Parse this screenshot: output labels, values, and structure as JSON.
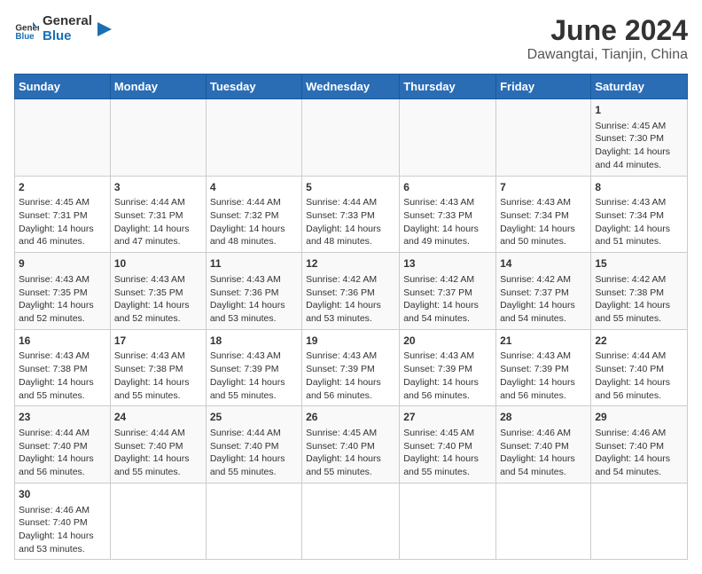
{
  "logo": {
    "text_general": "General",
    "text_blue": "Blue"
  },
  "title": "June 2024",
  "subtitle": "Dawangtai, Tianjin, China",
  "days_of_week": [
    "Sunday",
    "Monday",
    "Tuesday",
    "Wednesday",
    "Thursday",
    "Friday",
    "Saturday"
  ],
  "weeks": [
    [
      {
        "day": "",
        "info": ""
      },
      {
        "day": "",
        "info": ""
      },
      {
        "day": "",
        "info": ""
      },
      {
        "day": "",
        "info": ""
      },
      {
        "day": "",
        "info": ""
      },
      {
        "day": "",
        "info": ""
      },
      {
        "day": "1",
        "info": "Sunrise: 4:45 AM\nSunset: 7:30 PM\nDaylight: 14 hours and 44 minutes."
      }
    ],
    [
      {
        "day": "2",
        "info": "Sunrise: 4:45 AM\nSunset: 7:31 PM\nDaylight: 14 hours and 46 minutes."
      },
      {
        "day": "3",
        "info": "Sunrise: 4:44 AM\nSunset: 7:31 PM\nDaylight: 14 hours and 47 minutes."
      },
      {
        "day": "4",
        "info": "Sunrise: 4:44 AM\nSunset: 7:32 PM\nDaylight: 14 hours and 48 minutes."
      },
      {
        "day": "5",
        "info": "Sunrise: 4:44 AM\nSunset: 7:33 PM\nDaylight: 14 hours and 48 minutes."
      },
      {
        "day": "6",
        "info": "Sunrise: 4:43 AM\nSunset: 7:33 PM\nDaylight: 14 hours and 49 minutes."
      },
      {
        "day": "7",
        "info": "Sunrise: 4:43 AM\nSunset: 7:34 PM\nDaylight: 14 hours and 50 minutes."
      },
      {
        "day": "8",
        "info": "Sunrise: 4:43 AM\nSunset: 7:34 PM\nDaylight: 14 hours and 51 minutes."
      }
    ],
    [
      {
        "day": "9",
        "info": "Sunrise: 4:43 AM\nSunset: 7:35 PM\nDaylight: 14 hours and 52 minutes."
      },
      {
        "day": "10",
        "info": "Sunrise: 4:43 AM\nSunset: 7:35 PM\nDaylight: 14 hours and 52 minutes."
      },
      {
        "day": "11",
        "info": "Sunrise: 4:43 AM\nSunset: 7:36 PM\nDaylight: 14 hours and 53 minutes."
      },
      {
        "day": "12",
        "info": "Sunrise: 4:42 AM\nSunset: 7:36 PM\nDaylight: 14 hours and 53 minutes."
      },
      {
        "day": "13",
        "info": "Sunrise: 4:42 AM\nSunset: 7:37 PM\nDaylight: 14 hours and 54 minutes."
      },
      {
        "day": "14",
        "info": "Sunrise: 4:42 AM\nSunset: 7:37 PM\nDaylight: 14 hours and 54 minutes."
      },
      {
        "day": "15",
        "info": "Sunrise: 4:42 AM\nSunset: 7:38 PM\nDaylight: 14 hours and 55 minutes."
      }
    ],
    [
      {
        "day": "16",
        "info": "Sunrise: 4:43 AM\nSunset: 7:38 PM\nDaylight: 14 hours and 55 minutes."
      },
      {
        "day": "17",
        "info": "Sunrise: 4:43 AM\nSunset: 7:38 PM\nDaylight: 14 hours and 55 minutes."
      },
      {
        "day": "18",
        "info": "Sunrise: 4:43 AM\nSunset: 7:39 PM\nDaylight: 14 hours and 55 minutes."
      },
      {
        "day": "19",
        "info": "Sunrise: 4:43 AM\nSunset: 7:39 PM\nDaylight: 14 hours and 56 minutes."
      },
      {
        "day": "20",
        "info": "Sunrise: 4:43 AM\nSunset: 7:39 PM\nDaylight: 14 hours and 56 minutes."
      },
      {
        "day": "21",
        "info": "Sunrise: 4:43 AM\nSunset: 7:39 PM\nDaylight: 14 hours and 56 minutes."
      },
      {
        "day": "22",
        "info": "Sunrise: 4:44 AM\nSunset: 7:40 PM\nDaylight: 14 hours and 56 minutes."
      }
    ],
    [
      {
        "day": "23",
        "info": "Sunrise: 4:44 AM\nSunset: 7:40 PM\nDaylight: 14 hours and 56 minutes."
      },
      {
        "day": "24",
        "info": "Sunrise: 4:44 AM\nSunset: 7:40 PM\nDaylight: 14 hours and 55 minutes."
      },
      {
        "day": "25",
        "info": "Sunrise: 4:44 AM\nSunset: 7:40 PM\nDaylight: 14 hours and 55 minutes."
      },
      {
        "day": "26",
        "info": "Sunrise: 4:45 AM\nSunset: 7:40 PM\nDaylight: 14 hours and 55 minutes."
      },
      {
        "day": "27",
        "info": "Sunrise: 4:45 AM\nSunset: 7:40 PM\nDaylight: 14 hours and 55 minutes."
      },
      {
        "day": "28",
        "info": "Sunrise: 4:46 AM\nSunset: 7:40 PM\nDaylight: 14 hours and 54 minutes."
      },
      {
        "day": "29",
        "info": "Sunrise: 4:46 AM\nSunset: 7:40 PM\nDaylight: 14 hours and 54 minutes."
      }
    ],
    [
      {
        "day": "30",
        "info": "Sunrise: 4:46 AM\nSunset: 7:40 PM\nDaylight: 14 hours and 53 minutes."
      },
      {
        "day": "",
        "info": ""
      },
      {
        "day": "",
        "info": ""
      },
      {
        "day": "",
        "info": ""
      },
      {
        "day": "",
        "info": ""
      },
      {
        "day": "",
        "info": ""
      },
      {
        "day": "",
        "info": ""
      }
    ]
  ]
}
